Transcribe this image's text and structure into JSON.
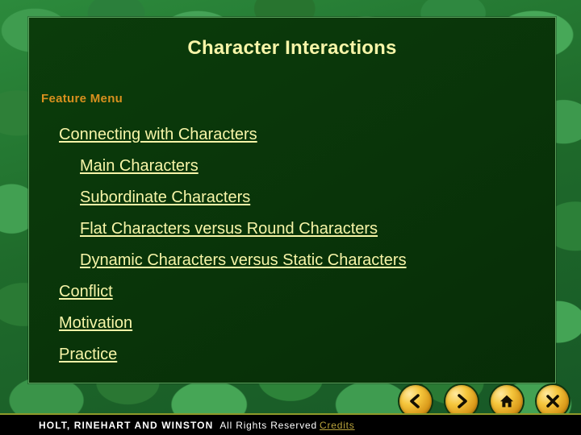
{
  "page": {
    "title": "Character Interactions",
    "section_label": "Feature Menu"
  },
  "menu": {
    "items": [
      {
        "label": "Connecting with Characters",
        "level": 1
      },
      {
        "label": "Main Characters",
        "level": 2
      },
      {
        "label": "Subordinate Characters",
        "level": 2
      },
      {
        "label": "Flat Characters versus Round Characters",
        "level": 2
      },
      {
        "label": "Dynamic Characters versus Static Characters",
        "level": 2
      },
      {
        "label": "Conflict",
        "level": 1
      },
      {
        "label": "Motivation",
        "level": 1
      },
      {
        "label": "Practice",
        "level": 1
      }
    ]
  },
  "footer": {
    "brand": "HOLT, RINEHART AND WINSTON",
    "rights": "All Rights Reserved",
    "credits_label": "Credits",
    "nav": {
      "previous_label": "Previous",
      "next_label": "Next",
      "collection_menu_label": "Collection Menu",
      "exit_label": "Exit",
      "icons": [
        "back-chevron-icon",
        "forward-chevron-icon",
        "home-icon",
        "close-x-icon"
      ]
    }
  },
  "colors": {
    "panel_background": "#093409",
    "panel_border": "#5aa05a",
    "title_text": "#F7F5A8",
    "section_label_text": "#D8901E",
    "link_text": "#F7F5A8",
    "button_gold": "#F5C63C",
    "credits_text": "#B9A33C",
    "footer_bar": "#000000",
    "gold_rule": "#8F9A2A"
  }
}
